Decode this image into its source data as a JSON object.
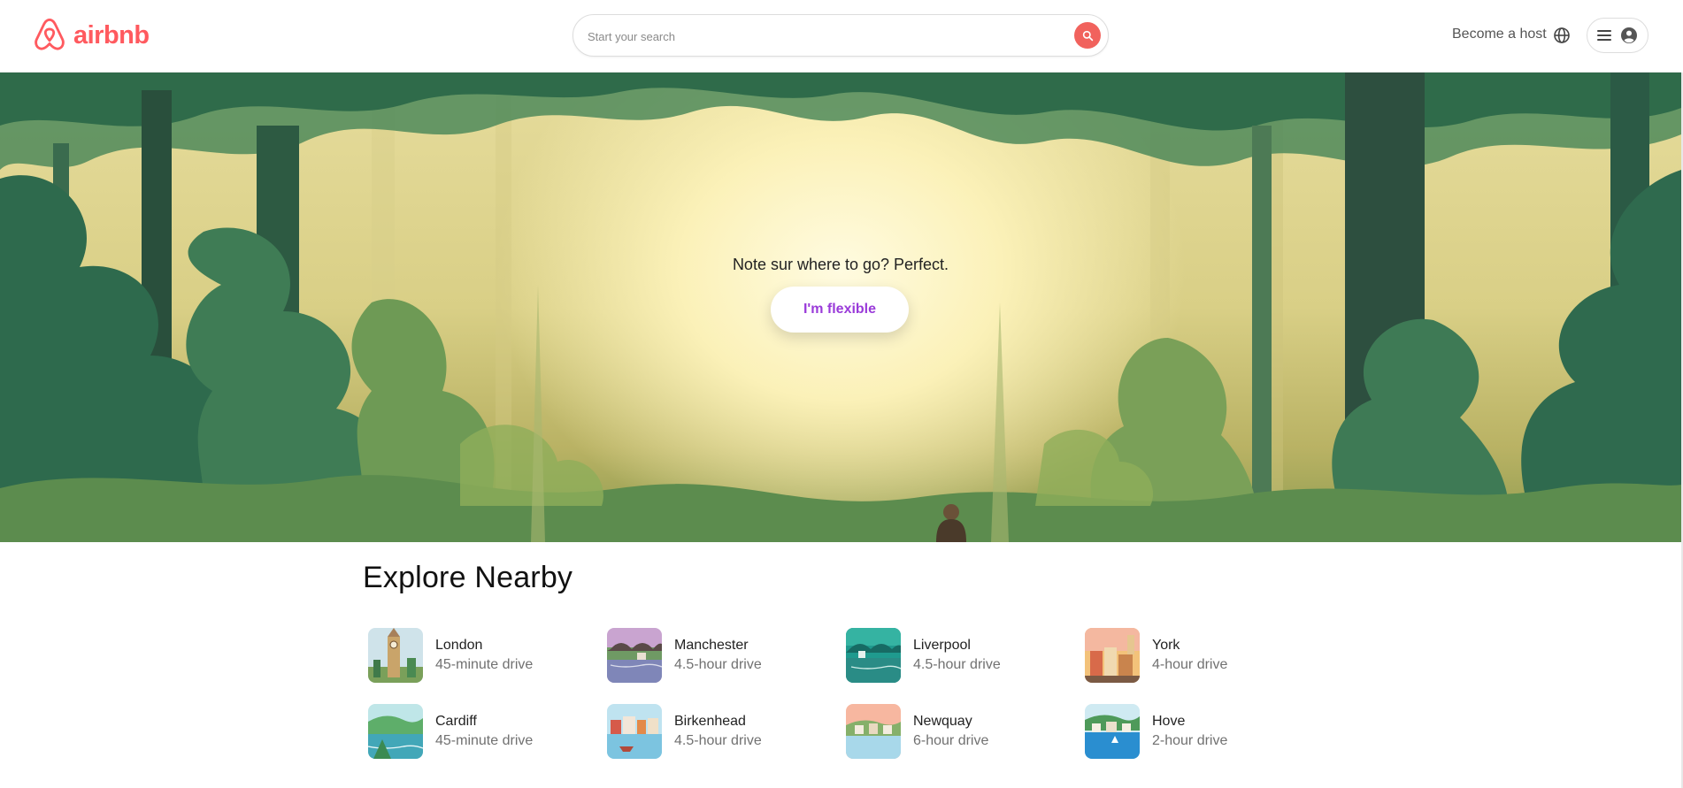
{
  "brand": {
    "name": "airbnb",
    "color": "#ff5a5f"
  },
  "search": {
    "placeholder": "Start your search",
    "button_color": "#f1625d"
  },
  "nav": {
    "host_label": "Become a host"
  },
  "hero": {
    "tagline": "Note sur where to go? Perfect.",
    "cta_label": "I'm flexible",
    "cta_color": "#9a3bd9"
  },
  "explore": {
    "title": "Explore Nearby",
    "places": [
      {
        "name": "London",
        "distance": "45-minute drive"
      },
      {
        "name": "Manchester",
        "distance": "4.5-hour drive"
      },
      {
        "name": "Liverpool",
        "distance": "4.5-hour drive"
      },
      {
        "name": "York",
        "distance": "4-hour drive"
      },
      {
        "name": "Cardiff",
        "distance": "45-minute drive"
      },
      {
        "name": "Birkenhead",
        "distance": "4.5-hour drive"
      },
      {
        "name": "Newquay",
        "distance": "6-hour drive"
      },
      {
        "name": "Hove",
        "distance": "2-hour drive"
      }
    ]
  }
}
